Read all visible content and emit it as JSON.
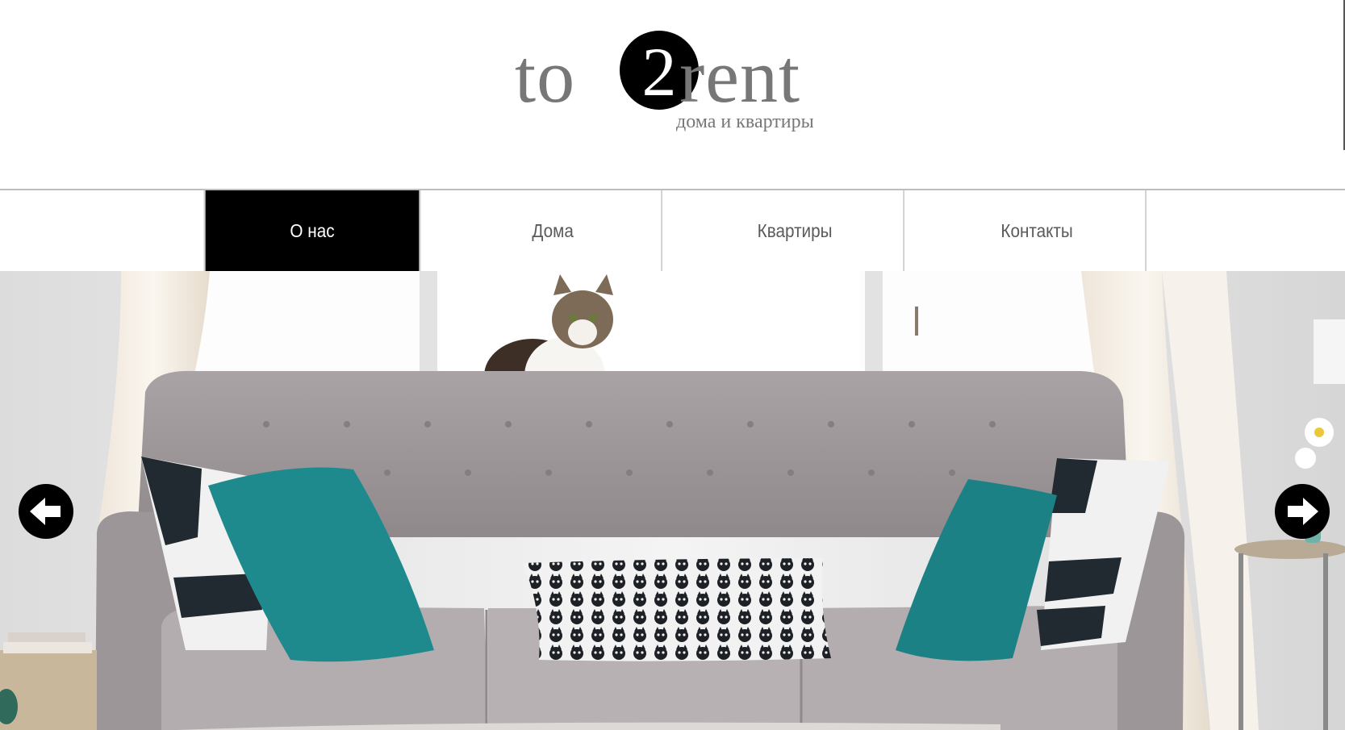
{
  "logo": {
    "left_word": "to",
    "digit": "2",
    "right_word": "rent",
    "tagline": "дома и квартиры"
  },
  "nav": {
    "items": [
      {
        "label": "О нас",
        "active": true
      },
      {
        "label": "Дома",
        "active": false
      },
      {
        "label": "Квартиры",
        "active": false
      },
      {
        "label": "Контакты",
        "active": false
      }
    ]
  },
  "slider": {
    "prev_icon": "arrow-left-icon",
    "next_icon": "arrow-right-icon"
  },
  "colors": {
    "logo_text": "#777777",
    "nav_active_bg": "#000000",
    "nav_text": "#5a5a5a",
    "pillow_teal": "#1f8a8e"
  }
}
